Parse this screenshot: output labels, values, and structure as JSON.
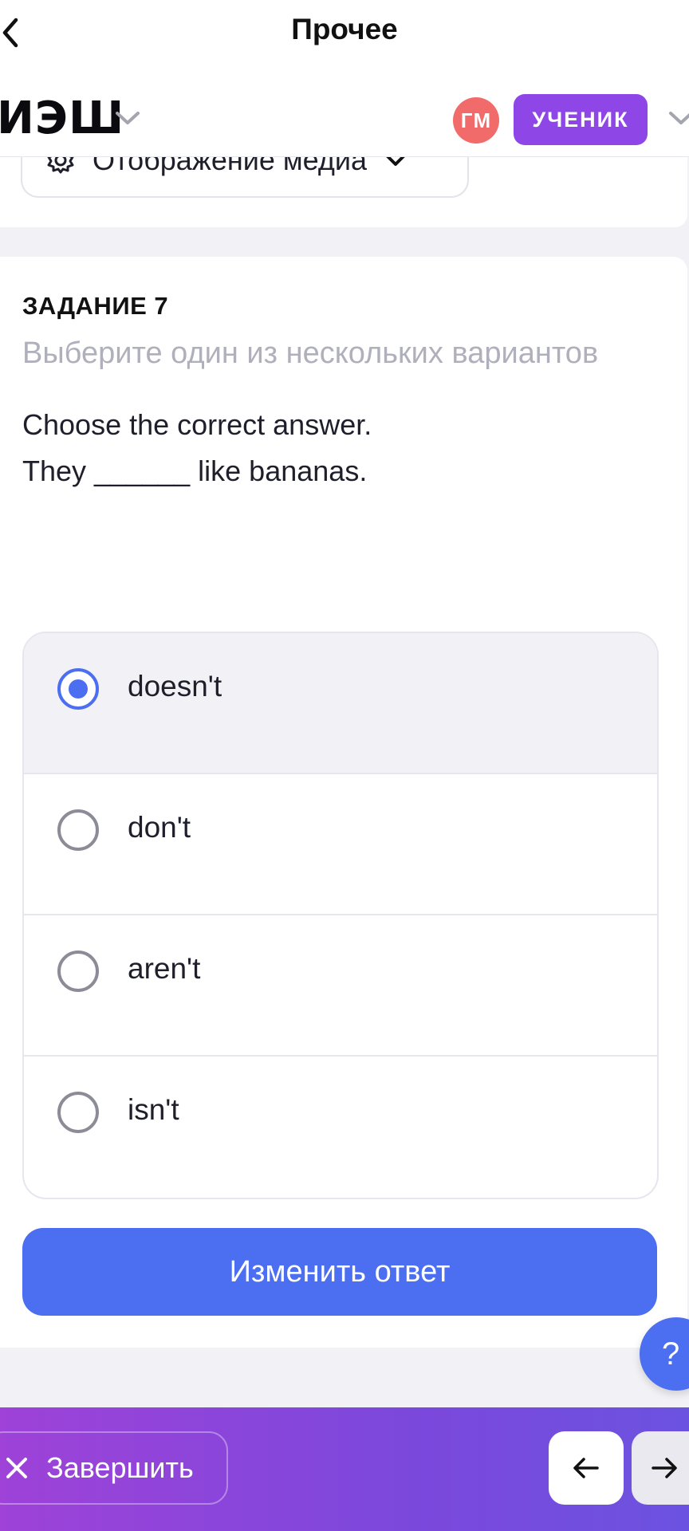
{
  "nav": {
    "title": "Прочее"
  },
  "header": {
    "brand": "ИЭШ",
    "avatar_initials": "ГМ",
    "role": "УЧЕНИК"
  },
  "prev_card": {
    "media_button_label": "Отображение медиа"
  },
  "task": {
    "number_label": "ЗАДАНИЕ 7",
    "hint": "Выберите один из нескольких вариантов",
    "question_line1": "Choose the correct answer.",
    "question_line2": "They ______ like bananas.",
    "options": [
      {
        "label": "doesn't",
        "selected": true
      },
      {
        "label": "don't",
        "selected": false
      },
      {
        "label": "aren't",
        "selected": false
      },
      {
        "label": "isn't",
        "selected": false
      }
    ],
    "change_answer_label": "Изменить ответ"
  },
  "help_button": "?",
  "bottom": {
    "finish_label": "Завершить"
  },
  "colors": {
    "accent": "#4c6ef0",
    "role_badge": "#8e46e6",
    "avatar": "#f26b6b",
    "bottom_gradient_start": "#9e42d8",
    "bottom_gradient_end": "#6c52e0"
  }
}
